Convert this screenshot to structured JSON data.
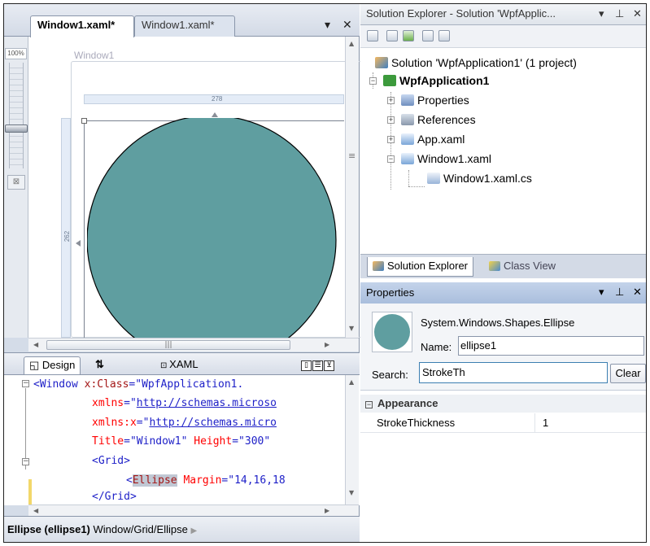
{
  "document_tabs": [
    {
      "label": "Window1.xaml*",
      "active": true
    },
    {
      "label": "Window1.xaml*",
      "active": false
    }
  ],
  "tab_controls": {
    "dropdown": "▾",
    "close": "✕"
  },
  "designer": {
    "zoom": "100%",
    "window_title": "Window1",
    "width_ruler": "278",
    "height_ruler": "262",
    "ellipse_fill": "#5f9ea0"
  },
  "split_view": {
    "design_tab": "Design",
    "swap": "⇅",
    "xaml_tab": "XAML"
  },
  "xaml_lines": {
    "l1_tag": "<Window ",
    "l1_attr": "x:Class",
    "l1_eq": "=",
    "l1_val": "\"WpfApplication1.",
    "l2_attr": "xmlns",
    "l2_q": "=\"",
    "l2_url": "http://schemas.microso",
    "l3_attr": "xmlns:x",
    "l3_q": "=\"",
    "l3_url": "http://schemas.micro",
    "l4_attr": "Title",
    "l4_val": "=\"Window1\"",
    "l4_attr2": " Height",
    "l4_val2": "=\"300\"",
    "l5_tag": "<Grid>",
    "l6_lt": "<",
    "l6_tag": "Ellipse",
    "l6_attr": " Margin",
    "l6_val": "=\"14,16,18",
    "l7_tag": "</Grid>"
  },
  "status": {
    "element": "Ellipse (ellipse1)",
    "path": "Window/Grid/Ellipse"
  },
  "solution_explorer": {
    "title": "Solution Explorer - Solution 'WpfApplic...",
    "controls": {
      "dropdown": "▾",
      "pin": "⊥",
      "close": "✕"
    },
    "tree": {
      "solution": "Solution 'WpfApplication1' (1 project)",
      "project": "WpfApplication1",
      "properties": "Properties",
      "references": "References",
      "app_xaml": "App.xaml",
      "window_xaml": "Window1.xaml",
      "window_cs": "Window1.xaml.cs"
    },
    "tabs": {
      "solution_explorer": "Solution Explorer",
      "class_view": "Class View"
    }
  },
  "properties": {
    "title": "Properties",
    "controls": {
      "dropdown": "▾",
      "pin": "⊥",
      "close": "✕"
    },
    "type": "System.Windows.Shapes.Ellipse",
    "name_label": "Name:",
    "name_value": "ellipse1",
    "search_label": "Search:",
    "search_value": "StrokeTh",
    "clear_label": "Clear",
    "category": "Appearance",
    "category_toggle": "−",
    "property_name": "StrokeThickness",
    "property_value": "1"
  }
}
